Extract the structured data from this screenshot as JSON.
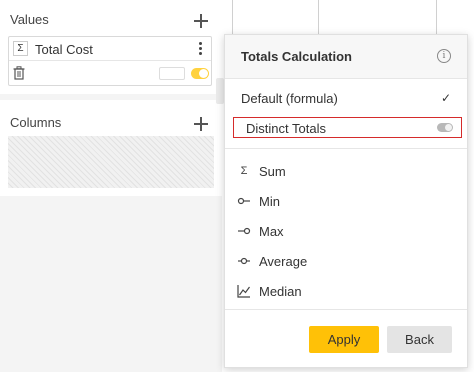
{
  "left_panel": {
    "values": {
      "title": "Values",
      "item": {
        "aggregation_symbol": "Σ",
        "name": "Total Cost"
      }
    },
    "columns": {
      "title": "Columns"
    }
  },
  "popup": {
    "title": "Totals Calculation",
    "info_icon": "i",
    "default_option": "Default (formula)",
    "check_mark": "✓",
    "distinct_totals": {
      "label": "Distinct Totals",
      "enabled": false
    },
    "functions": [
      {
        "label": "Sum",
        "icon": "sigma-icon",
        "glyph": "Σ"
      },
      {
        "label": "Min",
        "icon": "min-icon",
        "glyph": ""
      },
      {
        "label": "Max",
        "icon": "max-icon",
        "glyph": ""
      },
      {
        "label": "Average",
        "icon": "average-icon",
        "glyph": ""
      },
      {
        "label": "Median",
        "icon": "median-icon",
        "glyph": ""
      }
    ],
    "apply_label": "Apply",
    "back_label": "Back"
  },
  "colors": {
    "accent": "#ffc107",
    "highlight_border": "#d52b2b",
    "toggle_on": "#ffd23f"
  }
}
